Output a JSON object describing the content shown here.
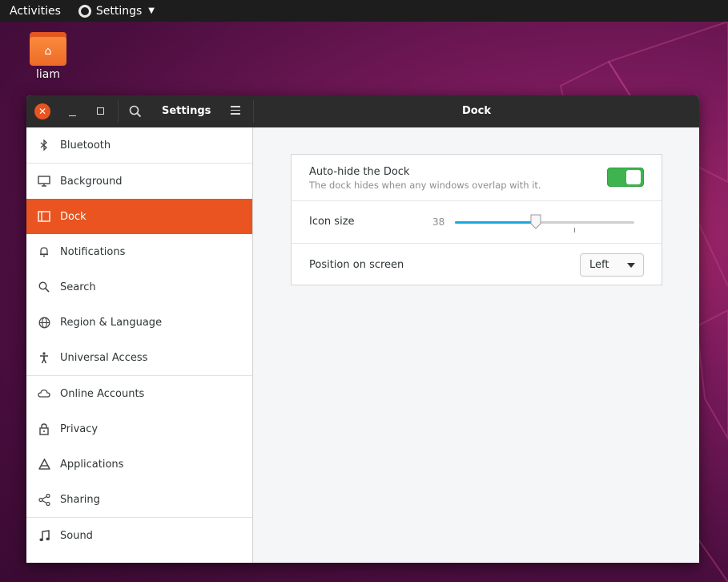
{
  "topbar": {
    "activities": "Activities",
    "app_name": "Settings"
  },
  "desktop": {
    "home_folder_label": "liam"
  },
  "window": {
    "sidebar_title": "Settings",
    "panel_title": "Dock"
  },
  "sidebar": {
    "items": [
      {
        "label": "Bluetooth",
        "icon": "bluetooth-icon"
      },
      {
        "label": "Background",
        "icon": "monitor-icon"
      },
      {
        "label": "Dock",
        "icon": "dock-icon",
        "active": true
      },
      {
        "label": "Notifications",
        "icon": "bell-icon"
      },
      {
        "label": "Search",
        "icon": "search-icon"
      },
      {
        "label": "Region & Language",
        "icon": "globe-icon"
      },
      {
        "label": "Universal Access",
        "icon": "accessibility-icon"
      },
      {
        "label": "Online Accounts",
        "icon": "cloud-icon"
      },
      {
        "label": "Privacy",
        "icon": "lock-icon"
      },
      {
        "label": "Applications",
        "icon": "applications-icon"
      },
      {
        "label": "Sharing",
        "icon": "share-icon"
      },
      {
        "label": "Sound",
        "icon": "music-note-icon"
      }
    ]
  },
  "dock": {
    "autohide": {
      "title": "Auto-hide the Dock",
      "subtitle": "The dock hides when any windows overlap with it.",
      "enabled": true
    },
    "icon_size": {
      "label": "Icon size",
      "value": "38",
      "fraction": 0.45
    },
    "position": {
      "label": "Position on screen",
      "selected": "Left"
    }
  },
  "colors": {
    "accent": "#e95420",
    "toggle_on": "#3eb34f",
    "slider_fill": "#18a8e0"
  }
}
